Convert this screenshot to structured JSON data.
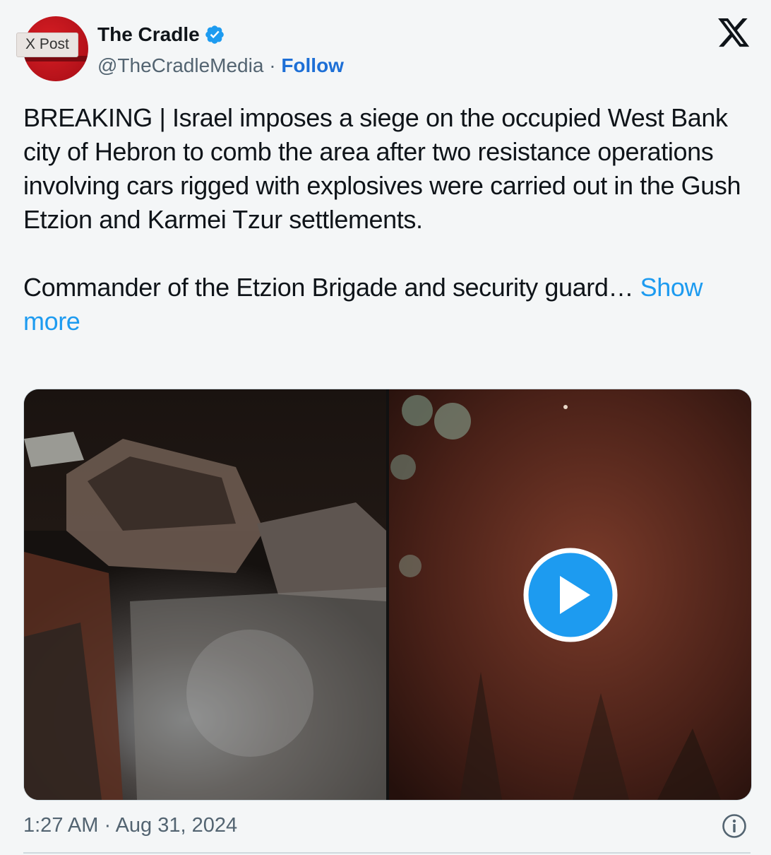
{
  "overlay_tag": "X Post",
  "author": {
    "name": "The Cradle",
    "handle": "@TheCradleMedia",
    "separator": "·",
    "follow_label": "Follow"
  },
  "post": {
    "paragraph1": "BREAKING | Israel imposes a siege on the occupied West Bank city of Hebron to comb the area after two resistance operations involving cars rigged with explosives were carried out in the Gush Etzion and Karmei Tzur settlements.",
    "paragraph2": "Commander of the Etzion Brigade and security guard…",
    "show_more_label": "Show more"
  },
  "media": {
    "items": [
      "photo",
      "video"
    ]
  },
  "timestamp": "1:27 AM · Aug 31, 2024",
  "colors": {
    "accent": "#1d9bf0",
    "follow": "#1d6fd6",
    "avatar": "#c8161d",
    "muted": "#536471"
  }
}
